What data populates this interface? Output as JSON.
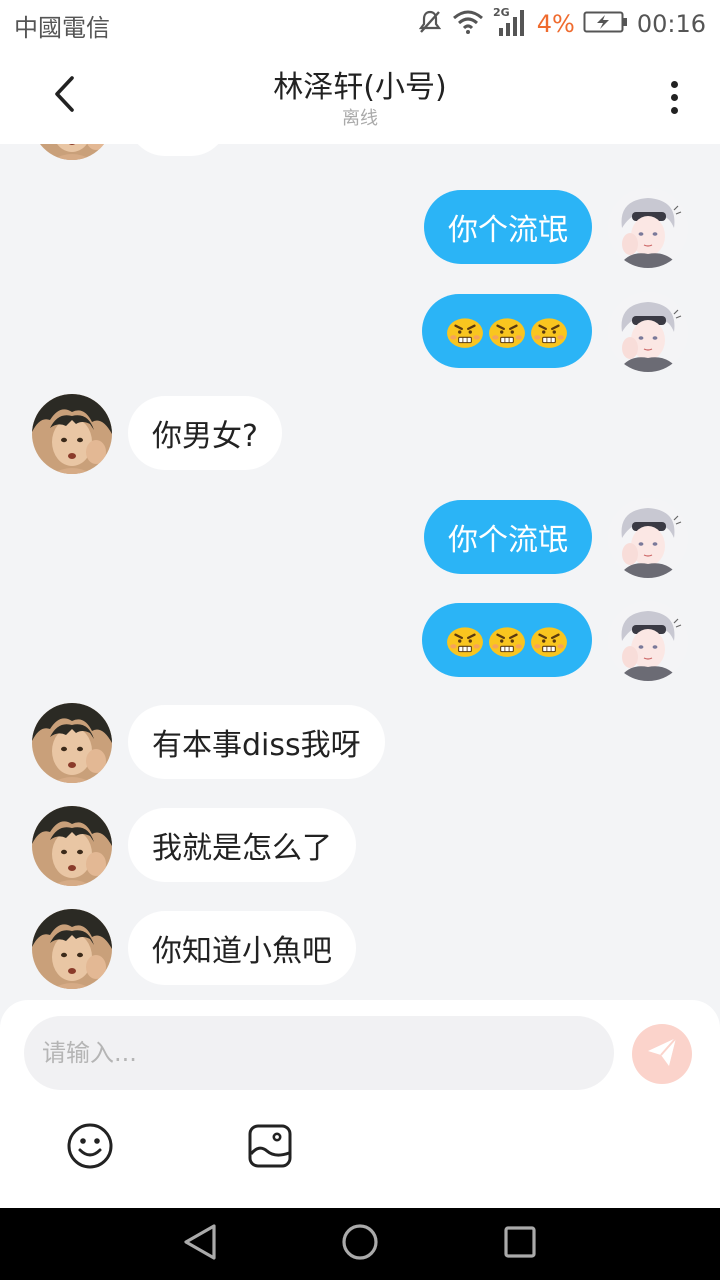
{
  "status_bar": {
    "carrier": "中國電信",
    "network": "2G",
    "battery": "4%",
    "time": "00:16",
    "icons": [
      "mute-icon",
      "wifi-icon",
      "signal-icon",
      "battery-charging-icon"
    ]
  },
  "header": {
    "title": "林泽轩(小号)",
    "subtitle": "离线",
    "back_icon": "chevron-left-icon",
    "more_icon": "more-vertical-icon"
  },
  "messages": [
    {
      "side": "left",
      "type": "text",
      "text": "",
      "avatar": "contact-avatar"
    },
    {
      "side": "right",
      "type": "text",
      "text": "你个流氓",
      "avatar": "self-avatar"
    },
    {
      "side": "right",
      "type": "emoji",
      "emoji": [
        "angry-face",
        "angry-face",
        "angry-face"
      ],
      "avatar": "self-avatar"
    },
    {
      "side": "left",
      "type": "text",
      "text": "你男女?",
      "avatar": "contact-avatar"
    },
    {
      "side": "right",
      "type": "text",
      "text": "你个流氓",
      "avatar": "self-avatar"
    },
    {
      "side": "right",
      "type": "emoji",
      "emoji": [
        "angry-face",
        "angry-face",
        "angry-face"
      ],
      "avatar": "self-avatar"
    },
    {
      "side": "left",
      "type": "text",
      "text": "有本事diss我呀",
      "avatar": "contact-avatar"
    },
    {
      "side": "left",
      "type": "text",
      "text": "我就是怎么了",
      "avatar": "contact-avatar"
    },
    {
      "side": "left",
      "type": "text",
      "text": "你知道小魚吧",
      "avatar": "contact-avatar"
    }
  ],
  "input": {
    "placeholder": "请输入...",
    "value": ""
  },
  "toolbar": {
    "emoji_icon": "smile-icon",
    "image_icon": "image-icon",
    "send_icon": "send-icon"
  },
  "colors": {
    "sent_bubble": "#2bb4f6",
    "received_bubble": "#ffffff",
    "background": "#f3f4f6",
    "send_button": "#fbd3cb",
    "battery_low": "#ef6b2e"
  }
}
